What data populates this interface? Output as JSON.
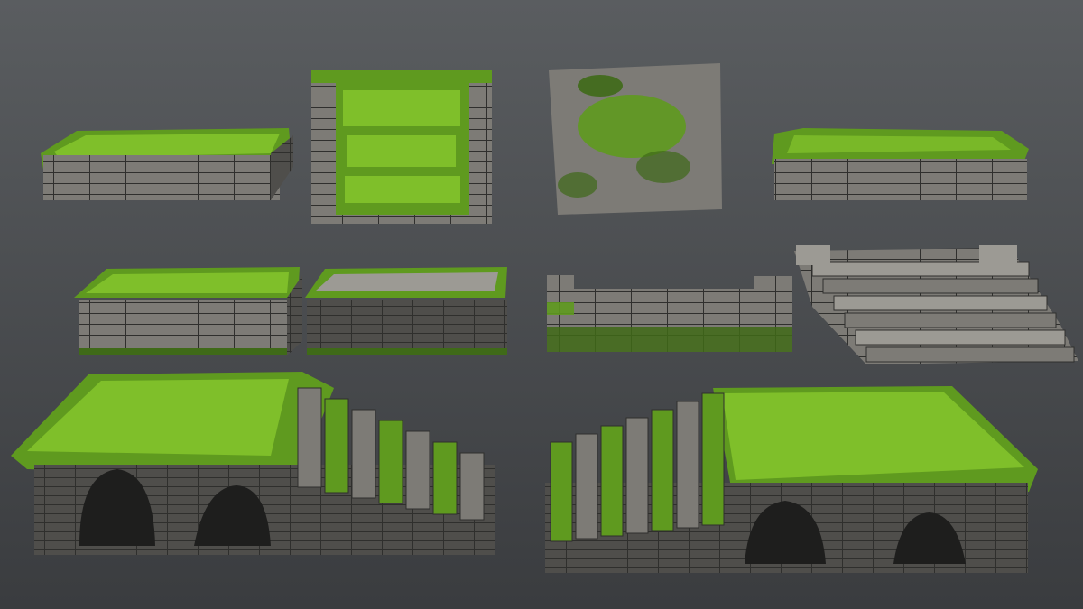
{
  "scene": {
    "background_top": "#5a5d60",
    "background_bottom": "#3a3c3f",
    "stone_light": "#9c9a94",
    "stone_mid": "#7d7b76",
    "stone_dark": "#4f4e4b",
    "mortar": "#2f2f2d",
    "moss_bright": "#7fbf2a",
    "moss_mid": "#5f9a1f",
    "moss_dark": "#3f6a18"
  },
  "assets": [
    {
      "name": "low-stone-slab-mossy-top",
      "kind": "slab"
    },
    {
      "name": "upright-stone-panel-mossy",
      "kind": "panel"
    },
    {
      "name": "weathered-stone-tile-mossy",
      "kind": "tile"
    },
    {
      "name": "low-stone-slab-light-moss",
      "kind": "slab"
    },
    {
      "name": "stone-block-wall-mossy-top",
      "kind": "block"
    },
    {
      "name": "stone-block-wall-brown",
      "kind": "block"
    },
    {
      "name": "ruined-low-wall",
      "kind": "wall"
    },
    {
      "name": "wide-stone-stairs",
      "kind": "stairs"
    },
    {
      "name": "mossy-arched-bridge-left-stairs",
      "kind": "bridge"
    },
    {
      "name": "mossy-arched-bridge-right-stairs",
      "kind": "bridge"
    }
  ]
}
